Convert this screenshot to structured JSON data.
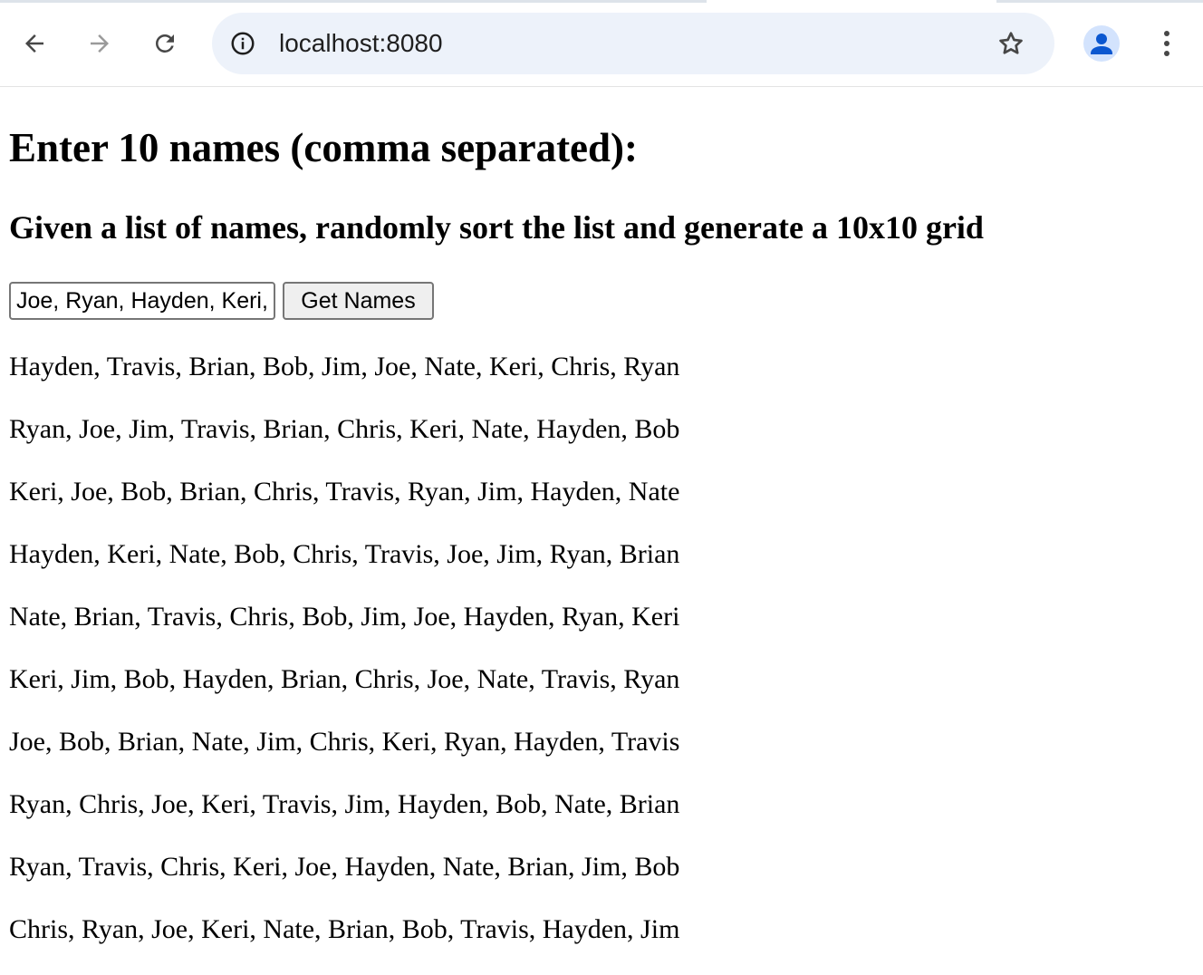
{
  "browser": {
    "url": "localhost:8080",
    "icons": {
      "back": "arrow-left-icon",
      "forward": "arrow-right-icon",
      "reload": "reload-icon",
      "site_info": "info-icon",
      "bookmark": "star-icon",
      "profile": "person-icon",
      "menu": "kebab-menu-icon"
    }
  },
  "page": {
    "heading": "Enter 10 names (comma separated):",
    "subheading": "Given a list of names, randomly sort the list and generate a 10x10 grid",
    "input_value": "Joe, Ryan, Hayden, Keri, Nate, Chris, Brian, Bob, Jim, Travis",
    "button_label": "Get Names",
    "rows": [
      "Hayden, Travis, Brian, Bob, Jim, Joe, Nate, Keri, Chris, Ryan",
      "Ryan, Joe, Jim, Travis, Brian, Chris, Keri, Nate, Hayden, Bob",
      "Keri, Joe, Bob, Brian, Chris, Travis, Ryan, Jim, Hayden, Nate",
      "Hayden, Keri, Nate, Bob, Chris, Travis, Joe, Jim, Ryan, Brian",
      "Nate, Brian, Travis, Chris, Bob, Jim, Joe, Hayden, Ryan, Keri",
      "Keri, Jim, Bob, Hayden, Brian, Chris, Joe, Nate, Travis, Ryan",
      "Joe, Bob, Brian, Nate, Jim, Chris, Keri, Ryan, Hayden, Travis",
      "Ryan, Chris, Joe, Keri, Travis, Jim, Hayden, Bob, Nate, Brian",
      "Ryan, Travis, Chris, Keri, Joe, Hayden, Nate, Brian, Jim, Bob",
      "Chris, Ryan, Joe, Keri, Nate, Brian, Bob, Travis, Hayden, Jim"
    ]
  }
}
